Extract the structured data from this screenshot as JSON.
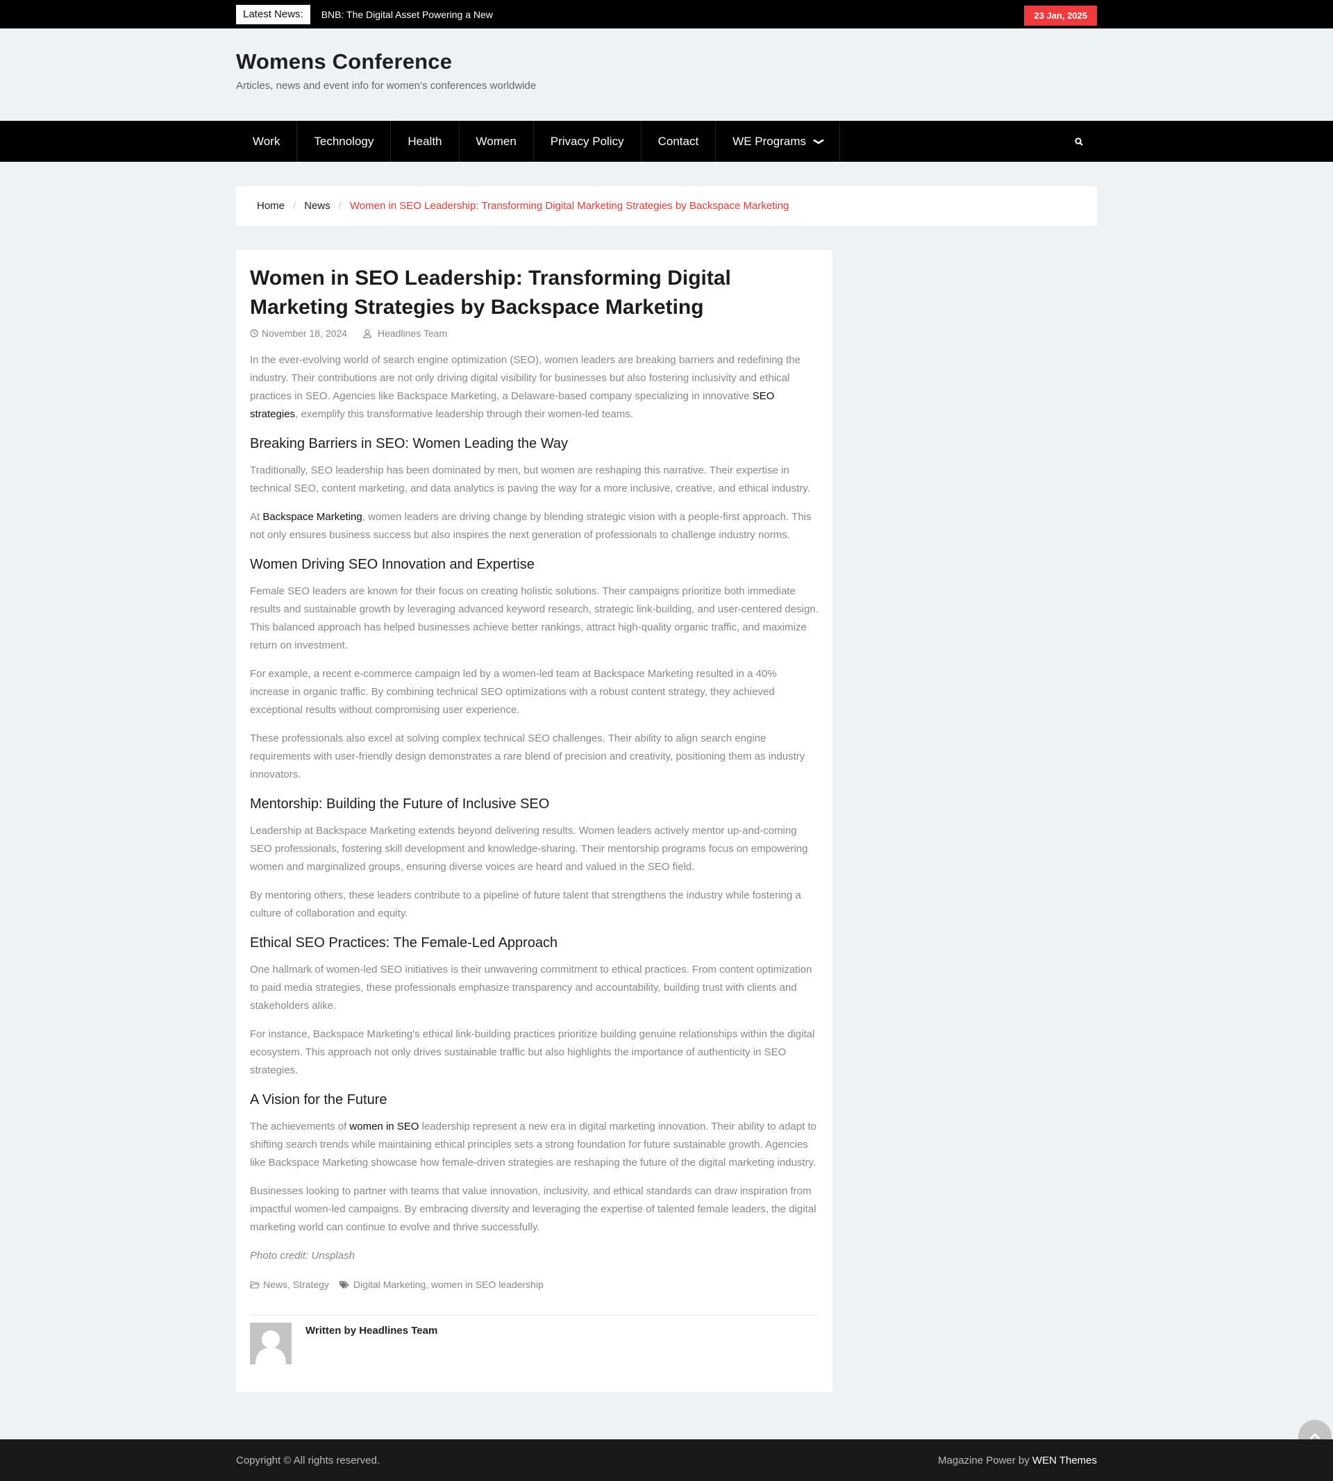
{
  "topbar": {
    "latest_label": "Latest News:",
    "latest_headline": "BNB: The Digital Asset Powering a New",
    "date": "23 Jan, 2025"
  },
  "header": {
    "site_title": "Womens Conference",
    "site_description": "Articles, news and event info for women's conferences worldwide"
  },
  "nav": {
    "items": [
      {
        "label": "Work"
      },
      {
        "label": "Technology"
      },
      {
        "label": "Health"
      },
      {
        "label": "Women"
      },
      {
        "label": "Privacy Policy"
      },
      {
        "label": "Contact"
      },
      {
        "label": "WE Programs",
        "has_dropdown": true
      }
    ],
    "search_icon": "search-icon"
  },
  "breadcrumb": {
    "items": [
      "Home",
      "News"
    ],
    "current": "Women in SEO Leadership: Transforming Digital Marketing Strategies by Backspace Marketing"
  },
  "article": {
    "title": "Women in SEO Leadership: Transforming Digital Marketing Strategies by Backspace Marketing",
    "date": "November 18, 2024",
    "author": "Headlines Team",
    "intro": {
      "before": "In the ever-evolving world of search engine optimization (SEO), women leaders are breaking barriers and redefining the industry. Their contributions are not only driving digital visibility for businesses but also fostering inclusivity and ethical practices in SEO. Agencies like Backspace Marketing, a Delaware-based company specializing in innovative ",
      "link": "SEO strategies",
      "after": ", exemplify this transformative leadership through their women-led teams."
    },
    "sections": [
      {
        "heading": "Breaking Barriers in SEO: Women Leading the Way",
        "p1": "Traditionally, SEO leadership has been dominated by men, but women are reshaping this narrative. Their expertise in technical SEO, content marketing, and data analytics is paving the way for a more inclusive, creative, and ethical industry.",
        "p2_before": "At ",
        "p2_link": "Backspace Marketing",
        "p2_after": ", women leaders are driving change by blending strategic vision with a people-first approach. This not only ensures business success but also inspires the next generation of professionals to challenge industry norms."
      },
      {
        "heading": "Women Driving SEO Innovation and Expertise",
        "p1": "Female SEO leaders are known for their focus on creating holistic solutions. Their campaigns prioritize both immediate results and sustainable growth by leveraging advanced keyword research, strategic link-building, and user-centered design. This balanced approach has helped businesses achieve better rankings, attract high-quality organic traffic, and maximize return on investment.",
        "p2": "For example, a recent e-commerce campaign led by a women-led team at Backspace Marketing resulted in a 40% increase in organic traffic. By combining technical SEO optimizations with a robust content strategy, they achieved exceptional results without compromising user experience.",
        "p3": "These professionals also excel at solving complex technical SEO challenges. Their ability to align search engine requirements with user-friendly design demonstrates a rare blend of precision and creativity, positioning them as industry innovators."
      },
      {
        "heading": "Mentorship: Building the Future of Inclusive SEO",
        "p1": "Leadership at Backspace Marketing extends beyond delivering results. Women leaders actively mentor up-and-coming SEO professionals, fostering skill development and knowledge-sharing. Their mentorship programs focus on empowering women and marginalized groups, ensuring diverse voices are heard and valued in the SEO field.",
        "p2": "By mentoring others, these leaders contribute to a pipeline of future talent that strengthens the industry while fostering a culture of collaboration and equity."
      },
      {
        "heading": "Ethical SEO Practices: The Female-Led Approach",
        "p1": "One hallmark of women-led SEO initiatives is their unwavering commitment to ethical practices. From content optimization to paid media strategies, these professionals emphasize transparency and accountability, building trust with clients and stakeholders alike.",
        "p2": "For instance, Backspace Marketing's ethical link-building practices prioritize building genuine relationships within the digital ecosystem. This approach not only drives sustainable traffic but also highlights the importance of authenticity in SEO strategies."
      },
      {
        "heading": "A Vision for the Future",
        "p1_before": "The achievements of ",
        "p1_link": "women in SEO",
        "p1_after": " leadership represent a new era in digital marketing innovation. Their ability to adapt to shifting search trends while maintaining ethical principles sets a strong foundation for future sustainable growth. Agencies like Backspace Marketing showcase how female-driven strategies are reshaping the future of the digital marketing industry.",
        "p2": "Businesses looking to partner with teams that value innovation, inclusivity, and ethical standards can draw inspiration from impactful women-led campaigns. By embracing diversity and leveraging the expertise of talented female leaders, the digital marketing world can continue to evolve and thrive successfully."
      }
    ],
    "photo_credit": "Photo credit: Unsplash",
    "categories": [
      "News",
      "Strategy"
    ],
    "tags": [
      "Digital Marketing",
      "women in SEO leadership"
    ],
    "written_by": "Written by Headlines Team"
  },
  "footer": {
    "copyright": "Copyright © All rights reserved.",
    "powered_prefix": "Magazine Power by ",
    "powered_link": "WEN Themes"
  },
  "colors": {
    "accent": "#ef3b3e",
    "breadcrumb_current": "#e33a3c",
    "topbar_bg": "#000000",
    "footer_bg": "#191919",
    "page_bg": "#eef2f5"
  }
}
